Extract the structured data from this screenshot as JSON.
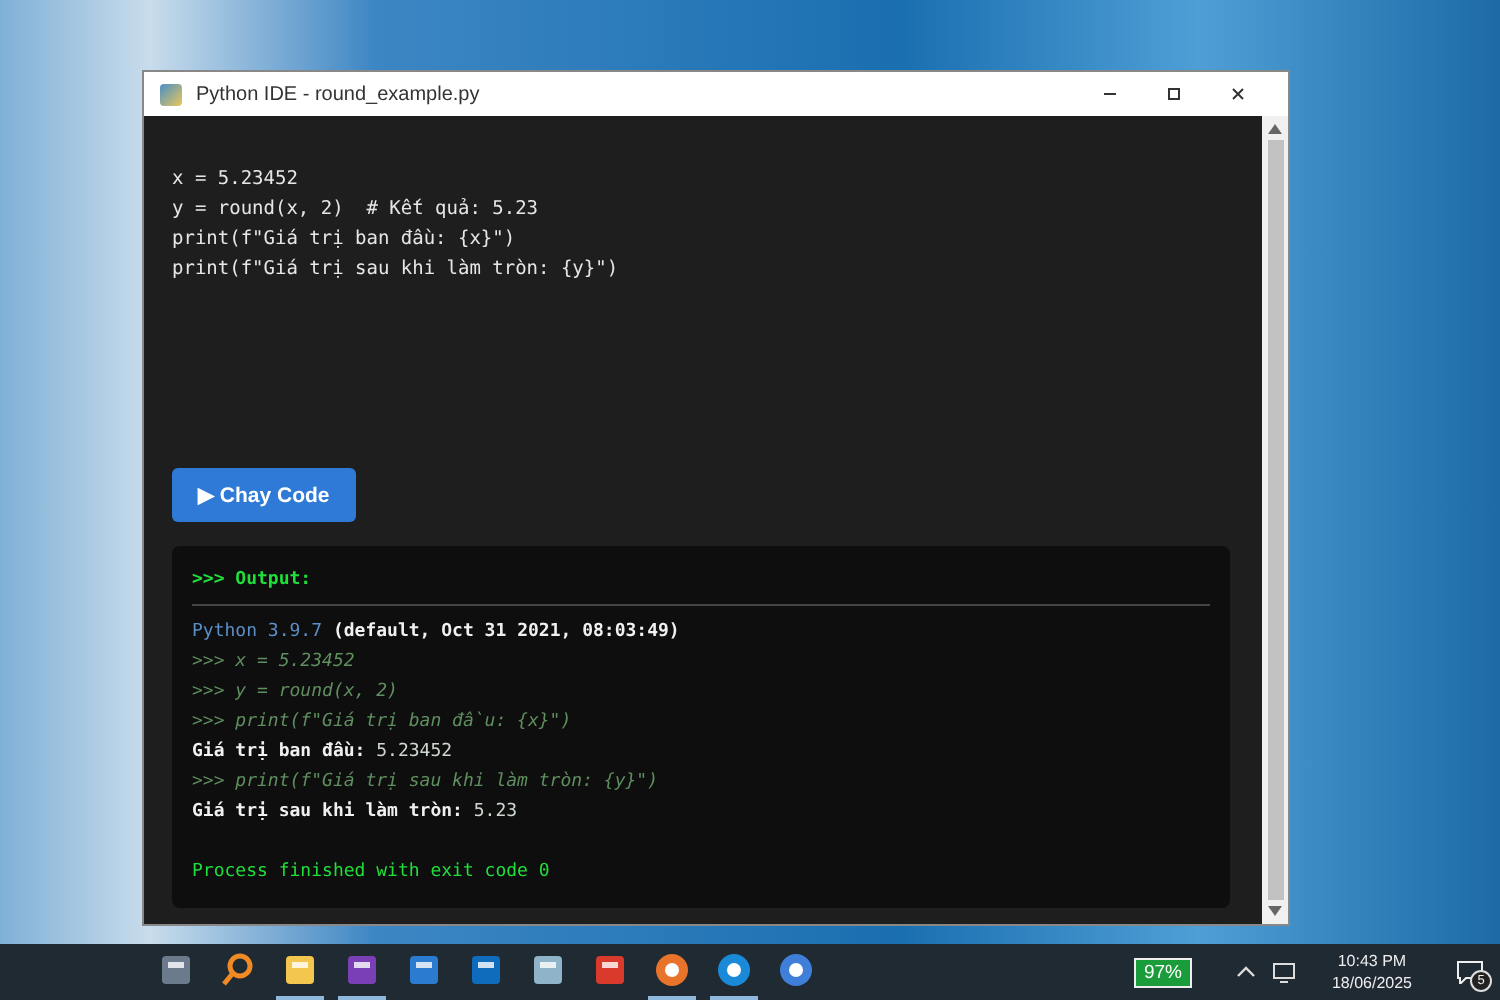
{
  "window": {
    "title": "Python IDE - round_example.py"
  },
  "editor": {
    "lines": [
      "x = 5.23452",
      "y = round(x, 2)  # Kết quả: 5.23",
      "print(f\"Giá trị ban đầu: {x}\")",
      "print(f\"Giá trị sau khi làm tròn: {y}\")"
    ]
  },
  "run_button": {
    "icon": "▶",
    "label": "Chay Code"
  },
  "output": {
    "header": ">>> Output:",
    "lines": [
      {
        "kind": "version",
        "name": "Python 3.9.7",
        "text": "(default, Oct 31 2021, 08:03:49)"
      },
      {
        "kind": "echo",
        "text": ">>> x = 5.23452"
      },
      {
        "kind": "echo",
        "text": ">>> y = round(x, 2)"
      },
      {
        "kind": "echo",
        "text": ">>> print(f\"Giá trị ban đầu: {x}\")"
      },
      {
        "kind": "result",
        "name": "Giá trị ban đầu:",
        "text": "5.23452"
      },
      {
        "kind": "echo",
        "text": ">>> print(f\"Giá trị sau khi làm tròn: {y}\")"
      },
      {
        "kind": "result",
        "name": "Giá trị sau khi làm tròn:",
        "text": "5.23"
      },
      {
        "kind": "blank"
      },
      {
        "kind": "exit",
        "text": "Process finished with exit code 0"
      }
    ]
  },
  "taskbar": {
    "apps": [
      {
        "kind": "calculator",
        "running": false
      },
      {
        "kind": "search",
        "running": false
      },
      {
        "kind": "folder",
        "running": true
      },
      {
        "kind": "notes",
        "running": true
      },
      {
        "kind": "store",
        "running": false
      },
      {
        "kind": "mail",
        "running": false
      },
      {
        "kind": "notebook",
        "running": false
      },
      {
        "kind": "photos",
        "running": false
      },
      {
        "kind": "vpn",
        "running": true
      },
      {
        "kind": "browser",
        "running": true
      },
      {
        "kind": "chrome",
        "running": false
      }
    ],
    "battery": "97%",
    "time": "10:43 PM",
    "date": "18/06/2025",
    "notifications": "5"
  }
}
